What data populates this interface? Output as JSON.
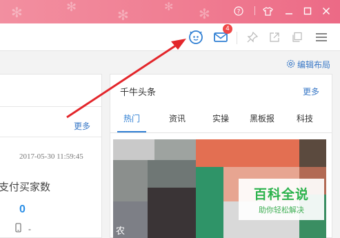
{
  "titlebar": {
    "icons": [
      "help-icon",
      "tshirt-skin-icon",
      "minimize-icon",
      "maximize-icon",
      "close-icon"
    ],
    "colors": {
      "from": "#f28fa0",
      "to": "#ec6a86"
    }
  },
  "toolbar": {
    "icons": [
      "chat-bot-icon",
      "mail-icon",
      "pin-icon",
      "share-icon",
      "window-icon",
      "menu-icon"
    ],
    "mail_badge": "4",
    "accent": "#2f7fd3"
  },
  "edit_layout": {
    "label": "编辑布局",
    "icon": "gear-icon"
  },
  "left_panel": {
    "more_label": "更多",
    "timestamp": "2017-05-30 11:59:45",
    "stat_label": "支付买家数",
    "stat_value": "0",
    "device_value": "-",
    "device_icon": "phone-icon"
  },
  "right_panel": {
    "title": "千牛头条",
    "more_label": "更多",
    "tabs": [
      {
        "label": "热门",
        "active": true
      },
      {
        "label": "资讯",
        "active": false
      },
      {
        "label": "实操",
        "active": false
      },
      {
        "label": "黑板报",
        "active": false
      },
      {
        "label": "科技",
        "active": false
      }
    ],
    "image_caption_char": "农"
  },
  "watermark": {
    "title": "百科全说",
    "subtitle": "助你轻松解决"
  }
}
